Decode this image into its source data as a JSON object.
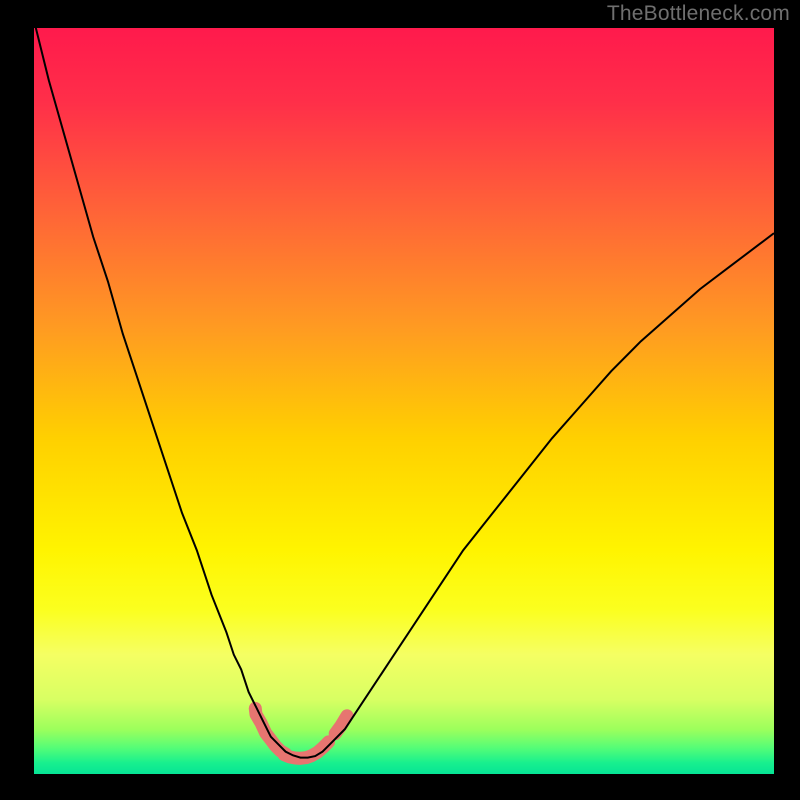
{
  "watermark": "TheBottleneck.com",
  "chart_data": {
    "type": "line",
    "title": "",
    "xlabel": "",
    "ylabel": "",
    "xlim": [
      0,
      100
    ],
    "ylim": [
      0,
      100
    ],
    "x": [
      0,
      2,
      4,
      6,
      8,
      10,
      12,
      14,
      16,
      18,
      20,
      22,
      24,
      26,
      27,
      28,
      29,
      30,
      31,
      32,
      33,
      34,
      35,
      36,
      37,
      38,
      39,
      40,
      42,
      44,
      46,
      48,
      50,
      54,
      58,
      62,
      66,
      70,
      74,
      78,
      82,
      86,
      90,
      94,
      98,
      100
    ],
    "series": [
      {
        "name": "curve",
        "values": [
          101,
          93,
          86,
          79,
          72,
          66,
          59,
          53,
          47,
          41,
          35,
          30,
          24,
          19,
          16,
          14,
          11,
          9,
          7,
          5,
          4,
          3,
          2.5,
          2.2,
          2.2,
          2.4,
          3,
          4,
          6,
          9,
          12,
          15,
          18,
          24,
          30,
          35,
          40,
          45,
          49.5,
          54,
          58,
          61.5,
          65,
          68,
          71,
          72.5
        ]
      }
    ],
    "highlight_segments": [
      {
        "name": "left-descent",
        "points": [
          {
            "x": 29.9,
            "y": 8.8
          },
          {
            "x": 30.0,
            "y": 8.0
          },
          {
            "x": 30.7,
            "y": 6.8
          },
          {
            "x": 31.3,
            "y": 5.5
          },
          {
            "x": 32.0,
            "y": 4.6
          },
          {
            "x": 32.6,
            "y": 3.8
          },
          {
            "x": 33.3,
            "y": 3.1
          },
          {
            "x": 34.0,
            "y": 2.7
          }
        ],
        "color": "#e77570"
      },
      {
        "name": "trough",
        "points": [
          {
            "x": 33.8,
            "y": 2.6
          },
          {
            "x": 34.5,
            "y": 2.3
          },
          {
            "x": 35.3,
            "y": 2.15
          },
          {
            "x": 36.0,
            "y": 2.1
          },
          {
            "x": 36.8,
            "y": 2.2
          },
          {
            "x": 37.5,
            "y": 2.45
          },
          {
            "x": 38.3,
            "y": 2.9
          },
          {
            "x": 39.0,
            "y": 3.5
          },
          {
            "x": 39.8,
            "y": 4.3
          }
        ],
        "color": "#e77570"
      },
      {
        "name": "right-rise",
        "points": [
          {
            "x": 40.7,
            "y": 5.4
          },
          {
            "x": 41.5,
            "y": 6.5
          },
          {
            "x": 42.3,
            "y": 7.8
          }
        ],
        "color": "#e77570"
      }
    ],
    "background": {
      "type": "vertical-gradient",
      "stops": [
        {
          "offset": 0.0,
          "color": "#ff1a4c"
        },
        {
          "offset": 0.1,
          "color": "#ff2f49"
        },
        {
          "offset": 0.25,
          "color": "#ff6537"
        },
        {
          "offset": 0.4,
          "color": "#ff9a22"
        },
        {
          "offset": 0.55,
          "color": "#ffd000"
        },
        {
          "offset": 0.7,
          "color": "#fff400"
        },
        {
          "offset": 0.78,
          "color": "#fbff1f"
        },
        {
          "offset": 0.84,
          "color": "#f5ff63"
        },
        {
          "offset": 0.9,
          "color": "#d8ff63"
        },
        {
          "offset": 0.94,
          "color": "#9dff5c"
        },
        {
          "offset": 0.965,
          "color": "#55fd77"
        },
        {
          "offset": 0.985,
          "color": "#18f08e"
        },
        {
          "offset": 1.0,
          "color": "#06e495"
        }
      ]
    },
    "curve_style": {
      "stroke": "#000000",
      "stroke_width": 2
    },
    "highlight_style": {
      "stroke_width": 13,
      "linecap": "round"
    }
  }
}
